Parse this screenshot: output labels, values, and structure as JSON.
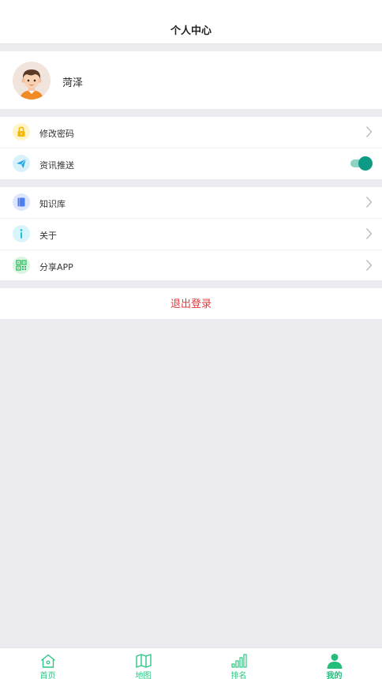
{
  "header": {
    "title": "个人中心"
  },
  "profile": {
    "name": "菏泽"
  },
  "settings": {
    "change_password": "修改密码",
    "news_push": "资讯推送",
    "news_push_enabled": true
  },
  "more": {
    "knowledge_base": "知识库",
    "about": "关于",
    "share_app": "分享APP"
  },
  "logout_label": "退出登录",
  "tabbar": {
    "items": [
      {
        "label": "首页",
        "icon": "home-icon"
      },
      {
        "label": "地图",
        "icon": "map-icon"
      },
      {
        "label": "排名",
        "icon": "ranking-icon"
      },
      {
        "label": "我的",
        "icon": "user-icon",
        "active": true
      }
    ]
  },
  "colors": {
    "accent": "#2cc783",
    "toggle": "#0e9a84",
    "danger": "#e4393c",
    "background": "#ebebf0"
  }
}
